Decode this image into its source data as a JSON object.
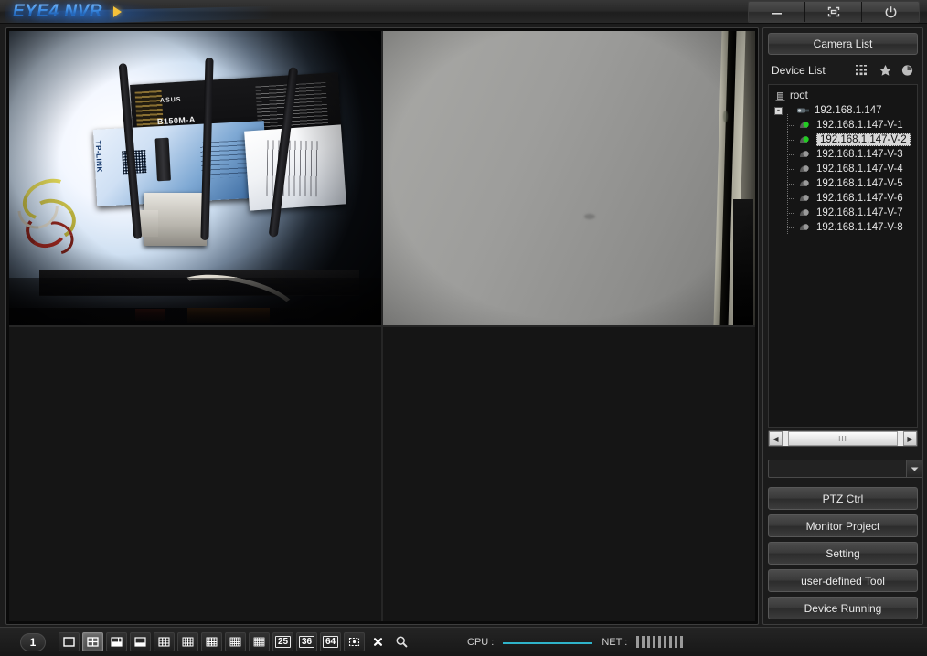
{
  "window": {
    "title": "EYE4 NVR",
    "logo_text": "EYE4 NVR",
    "controls": [
      {
        "name": "minimize",
        "icon": "minimize-icon",
        "label": "Minimize"
      },
      {
        "name": "maximize",
        "icon": "fullscreen-icon",
        "label": "Maximize"
      },
      {
        "name": "power",
        "icon": "power-icon",
        "label": "Exit"
      }
    ]
  },
  "video": {
    "layout": "2x2",
    "panes": [
      {
        "index": 1,
        "state": "live",
        "selected": false,
        "osd": "",
        "description": "Fisheye view of desk with ASUS B150M-A motherboard box, TP-LINK router box, antennas and cables",
        "labels": {
          "asus": "ASUS",
          "model": "B150M-A",
          "tplink": "TP-LINK"
        }
      },
      {
        "index": 2,
        "state": "live",
        "selected": true,
        "osd": "",
        "description": "Gray wall with dark door frame edge at right"
      },
      {
        "index": 3,
        "state": "empty",
        "selected": false,
        "osd": ""
      },
      {
        "index": 4,
        "state": "empty",
        "selected": false,
        "osd": ""
      }
    ]
  },
  "toolbar": {
    "page_number": "1",
    "layouts": [
      {
        "id": "single",
        "label": "1",
        "icon": "layout-1-icon",
        "active": false
      },
      {
        "id": "quad",
        "label": "4",
        "icon": "layout-4-icon",
        "active": true
      },
      {
        "id": "six",
        "label": "6",
        "icon": "layout-6-icon",
        "active": false
      },
      {
        "id": "eight",
        "label": "8",
        "icon": "layout-8-icon",
        "active": false
      },
      {
        "id": "nine",
        "label": "9",
        "icon": "layout-9-icon",
        "active": false
      },
      {
        "id": "twelve",
        "label": "12",
        "icon": "layout-12-icon",
        "active": false
      },
      {
        "id": "thirteen",
        "label": "13",
        "icon": "layout-13-icon",
        "active": false
      },
      {
        "id": "sixteen",
        "label": "16",
        "icon": "layout-16-icon",
        "active": false
      },
      {
        "id": "twenty",
        "label": "20",
        "icon": "layout-20-icon",
        "active": false
      }
    ],
    "numeric_layouts": [
      {
        "id": "l25",
        "label": "25"
      },
      {
        "id": "l36",
        "label": "36"
      },
      {
        "id": "l64",
        "label": "64"
      }
    ],
    "extra": [
      {
        "id": "custom",
        "icon": "custom-layout-icon",
        "label": "Custom layout"
      },
      {
        "id": "closeall",
        "icon": "close-all-icon",
        "label": "Close all"
      },
      {
        "id": "zoom",
        "icon": "magnifier-icon",
        "label": "Zoom"
      }
    ],
    "status": {
      "cpu_label": "CPU :",
      "cpu_value": "",
      "net_label": "NET :",
      "net_bars": 9,
      "cpu_color": "#2fb3c9"
    }
  },
  "sidebar": {
    "header_button": "Camera List",
    "device_list_label": "Device List",
    "header_icons": [
      {
        "name": "grid-view-icon",
        "label": "Grid view"
      },
      {
        "name": "favorites-star-icon",
        "label": "Favorites"
      },
      {
        "name": "history-clock-icon",
        "label": "History"
      }
    ],
    "tree": {
      "root": {
        "label": "root",
        "icon": "server-rack-icon"
      },
      "device": {
        "label": "192.168.1.147",
        "icon": "camera-device-icon",
        "expander": "-"
      },
      "cameras": [
        {
          "label": "192.168.1.147-V-1",
          "online": true,
          "selected": false
        },
        {
          "label": "192.168.1.147-V-2",
          "online": true,
          "selected": true
        },
        {
          "label": "192.168.1.147-V-3",
          "online": false,
          "selected": false
        },
        {
          "label": "192.168.1.147-V-4",
          "online": false,
          "selected": false
        },
        {
          "label": "192.168.1.147-V-5",
          "online": false,
          "selected": false
        },
        {
          "label": "192.168.1.147-V-6",
          "online": false,
          "selected": false
        },
        {
          "label": "192.168.1.147-V-7",
          "online": false,
          "selected": false
        },
        {
          "label": "192.168.1.147-V-8",
          "online": false,
          "selected": false
        }
      ]
    },
    "scrollbar": {
      "left_arrow": "◀",
      "right_arrow": "▶",
      "thumb_grip": "III"
    },
    "search": {
      "value": "",
      "placeholder": "",
      "icon": "magnifier-icon"
    },
    "buttons": [
      {
        "id": "ptz",
        "label": "PTZ Ctrl"
      },
      {
        "id": "monitor",
        "label": "Monitor Project"
      },
      {
        "id": "setting",
        "label": "Setting"
      },
      {
        "id": "userdefined",
        "label": "user-defined Tool"
      },
      {
        "id": "running",
        "label": "Device Running"
      }
    ]
  },
  "colors": {
    "selection_blue": "#2d8ed0",
    "online_green": "#22cc22",
    "offline_gray": "#8a8a8a",
    "cpu_cyan": "#2fb3c9",
    "panel_bg": "#1b1b1b"
  }
}
